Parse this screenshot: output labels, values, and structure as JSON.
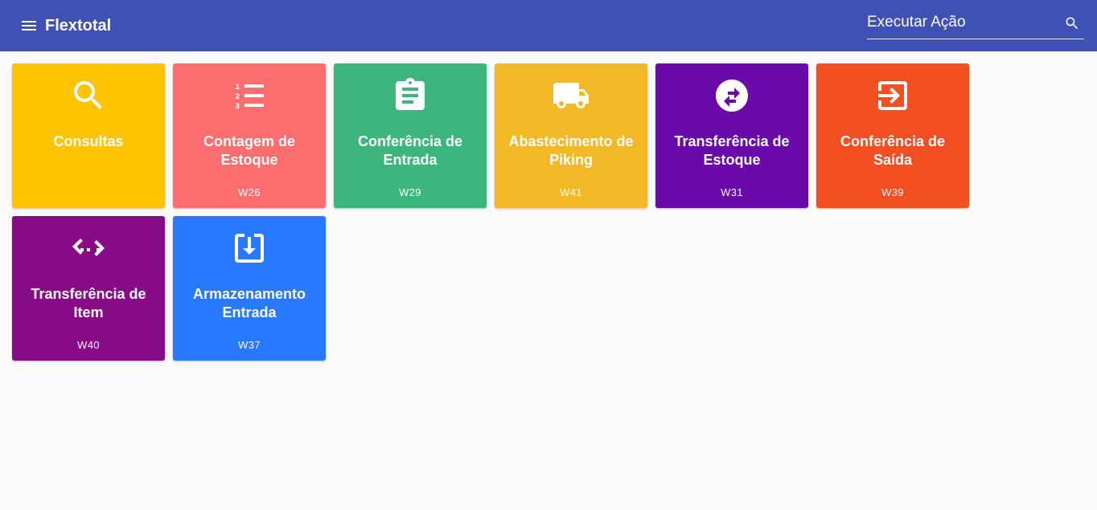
{
  "header": {
    "title": "Flextotal",
    "search_placeholder": "Executar Ação",
    "background_color": "#3f51b5"
  },
  "tiles": [
    {
      "label": "Consultas",
      "code": "",
      "color": "#ffc400",
      "icon": "search-icon"
    },
    {
      "label": "Contagem de Estoque",
      "code": "W26",
      "color": "#ff6e6e",
      "icon": "numbered-list-icon"
    },
    {
      "label": "Conferência de Entrada",
      "code": "W29",
      "color": "#3db67e",
      "icon": "clipboard-icon"
    },
    {
      "label": "Abastecimento de Piking",
      "code": "W41",
      "color": "#f2b826",
      "icon": "truck-icon"
    },
    {
      "label": "Transferência de Estoque",
      "code": "W31",
      "color": "#6a0aaa",
      "icon": "swap-arrows-icon"
    },
    {
      "label": "Conferência de Saída",
      "code": "W39",
      "color": "#f44e23",
      "icon": "exit-arrow-icon"
    },
    {
      "label": "Transferência de Item",
      "code": "W40",
      "color": "#870b87",
      "icon": "code-dots-icon"
    },
    {
      "label": "Armazenamento Entrada",
      "code": "W37",
      "color": "#2979ff",
      "icon": "download-box-icon"
    }
  ]
}
